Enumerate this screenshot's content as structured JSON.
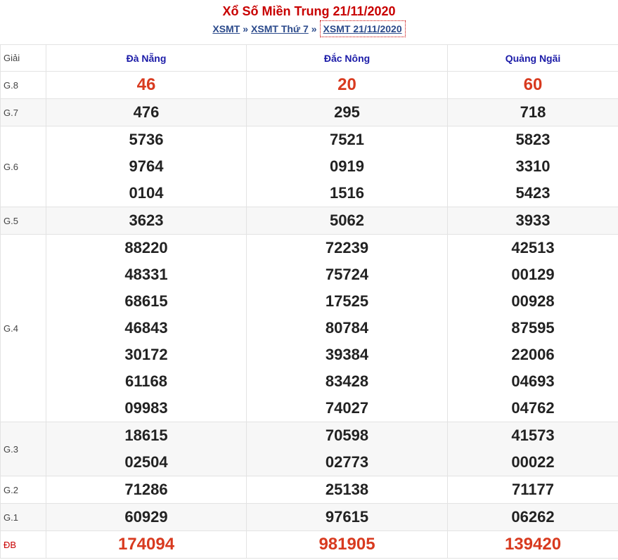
{
  "title": "Xổ Số Miền Trung 21/11/2020",
  "breadcrumb": {
    "home": "XSMT",
    "sep1": "»",
    "day": "XSMT Thứ 7",
    "sep2": "»",
    "current": "XSMT 21/11/2020"
  },
  "table": {
    "label_header": "Giải",
    "provinces": [
      "Đà Nẵng",
      "Đắc Nông",
      "Quảng Ngãi"
    ],
    "prizes": {
      "g8": {
        "label": "G.8",
        "values": [
          [
            "46"
          ],
          [
            "20"
          ],
          [
            "60"
          ]
        ]
      },
      "g7": {
        "label": "G.7",
        "values": [
          [
            "476"
          ],
          [
            "295"
          ],
          [
            "718"
          ]
        ]
      },
      "g6": {
        "label": "G.6",
        "values": [
          [
            "5736",
            "9764",
            "0104"
          ],
          [
            "7521",
            "0919",
            "1516"
          ],
          [
            "5823",
            "3310",
            "5423"
          ]
        ]
      },
      "g5": {
        "label": "G.5",
        "values": [
          [
            "3623"
          ],
          [
            "5062"
          ],
          [
            "3933"
          ]
        ]
      },
      "g4": {
        "label": "G.4",
        "values": [
          [
            "88220",
            "48331",
            "68615",
            "46843",
            "30172",
            "61168",
            "09983"
          ],
          [
            "72239",
            "75724",
            "17525",
            "80784",
            "39384",
            "83428",
            "74027"
          ],
          [
            "42513",
            "00129",
            "00928",
            "87595",
            "22006",
            "04693",
            "04762"
          ]
        ]
      },
      "g3": {
        "label": "G.3",
        "values": [
          [
            "18615",
            "02504"
          ],
          [
            "70598",
            "02773"
          ],
          [
            "41573",
            "00022"
          ]
        ]
      },
      "g2": {
        "label": "G.2",
        "values": [
          [
            "71286"
          ],
          [
            "25138"
          ],
          [
            "71177"
          ]
        ]
      },
      "g1": {
        "label": "G.1",
        "values": [
          [
            "60929"
          ],
          [
            "97615"
          ],
          [
            "06262"
          ]
        ]
      },
      "db": {
        "label": "ĐB",
        "values": [
          [
            "174094"
          ],
          [
            "981905"
          ],
          [
            "139420"
          ]
        ]
      }
    }
  },
  "colors": {
    "title": "#c80000",
    "highlight_number": "#d83a1f",
    "province_header": "#1c1ca8",
    "link": "#2b4a8b"
  }
}
